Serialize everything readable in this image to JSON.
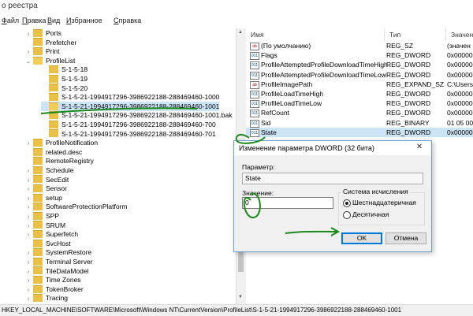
{
  "window": {
    "title": "о реестра"
  },
  "menu": [
    "Файл",
    "Правка",
    "Вид",
    "Избранное",
    "Справка"
  ],
  "tree": {
    "items": [
      {
        "label": "Ports",
        "level": 1,
        "expander": "›",
        "open": false,
        "selected": false
      },
      {
        "label": "Prefetcher",
        "level": 1,
        "expander": "",
        "open": false,
        "selected": false
      },
      {
        "label": "Print",
        "level": 1,
        "expander": "›",
        "open": false,
        "selected": false
      },
      {
        "label": "ProfileList",
        "level": 1,
        "expander": "⌄",
        "open": true,
        "selected": false
      },
      {
        "label": "S-1-5-18",
        "level": 2,
        "expander": "",
        "open": false,
        "selected": false
      },
      {
        "label": "S-1-5-19",
        "level": 2,
        "expander": "",
        "open": false,
        "selected": false
      },
      {
        "label": "S-1-5-20",
        "level": 2,
        "expander": "",
        "open": false,
        "selected": false
      },
      {
        "label": "S-1-5-21-1994917296-3986922188-288469460-1000",
        "level": 2,
        "expander": "",
        "open": false,
        "selected": false
      },
      {
        "label": "S-1-5-21-1994917296-3986922188-288469460-1001",
        "level": 2,
        "expander": "",
        "open": true,
        "selected": true
      },
      {
        "label": "S-1-5-21-1994917296-3986922188-288469460-1001.bak",
        "level": 2,
        "expander": "",
        "open": false,
        "selected": false
      },
      {
        "label": "S-1-5-21-1994917296-3986922188-288469460-700",
        "level": 2,
        "expander": "",
        "open": false,
        "selected": false
      },
      {
        "label": "S-1-5-21-1994917296-3986922188-288469460-701",
        "level": 2,
        "expander": "",
        "open": false,
        "selected": false
      },
      {
        "label": "ProfileNotification",
        "level": 1,
        "expander": "›",
        "open": false,
        "selected": false
      },
      {
        "label": "related.desc",
        "level": 1,
        "expander": "",
        "open": false,
        "selected": false
      },
      {
        "label": "RemoteRegistry",
        "level": 1,
        "expander": "",
        "open": false,
        "selected": false
      },
      {
        "label": "Schedule",
        "level": 1,
        "expander": "›",
        "open": false,
        "selected": false
      },
      {
        "label": "SecEdit",
        "level": 1,
        "expander": "›",
        "open": false,
        "selected": false
      },
      {
        "label": "Sensor",
        "level": 1,
        "expander": "›",
        "open": false,
        "selected": false
      },
      {
        "label": "setup",
        "level": 1,
        "expander": "›",
        "open": false,
        "selected": false
      },
      {
        "label": "SoftwareProtectionPlatform",
        "level": 1,
        "expander": "›",
        "open": false,
        "selected": false
      },
      {
        "label": "SPP",
        "level": 1,
        "expander": "›",
        "open": false,
        "selected": false
      },
      {
        "label": "SRUM",
        "level": 1,
        "expander": "›",
        "open": false,
        "selected": false
      },
      {
        "label": "Superfetch",
        "level": 1,
        "expander": "›",
        "open": false,
        "selected": false
      },
      {
        "label": "SvcHost",
        "level": 1,
        "expander": "",
        "open": false,
        "selected": false
      },
      {
        "label": "SystemRestore",
        "level": 1,
        "expander": "›",
        "open": false,
        "selected": false
      },
      {
        "label": "Terminal Server",
        "level": 1,
        "expander": "›",
        "open": false,
        "selected": false
      },
      {
        "label": "TileDataModel",
        "level": 1,
        "expander": "›",
        "open": false,
        "selected": false
      },
      {
        "label": "Time Zones",
        "level": 1,
        "expander": "›",
        "open": false,
        "selected": false
      },
      {
        "label": "TokenBroker",
        "level": 1,
        "expander": "›",
        "open": false,
        "selected": false
      },
      {
        "label": "Tracing",
        "level": 1,
        "expander": "›",
        "open": false,
        "selected": false
      }
    ]
  },
  "values_pane": {
    "columns": [
      "Имя",
      "Тип",
      "Значен"
    ],
    "rows": [
      {
        "name": "(По умолчанию)",
        "type": "REG_SZ",
        "value": "(значен",
        "icon": "ab"
      },
      {
        "name": "Flags",
        "type": "REG_DWORD",
        "value": "0x000000",
        "icon": "011"
      },
      {
        "name": "ProfileAttemptedProfileDownloadTimeHigh",
        "type": "REG_DWORD",
        "value": "0x000000",
        "icon": "011"
      },
      {
        "name": "ProfileAttemptedProfileDownloadTimeLow",
        "type": "REG_DWORD",
        "value": "0x000000",
        "icon": "011"
      },
      {
        "name": "ProfileImagePath",
        "type": "REG_EXPAND_SZ",
        "value": "C:\\Users",
        "icon": "ab"
      },
      {
        "name": "ProfileLoadTimeHigh",
        "type": "REG_DWORD",
        "value": "0x000000",
        "icon": "011"
      },
      {
        "name": "ProfileLoadTimeLow",
        "type": "REG_DWORD",
        "value": "0x000000",
        "icon": "011"
      },
      {
        "name": "RefCount",
        "type": "REG_DWORD",
        "value": "0x000000",
        "icon": "011"
      },
      {
        "name": "Sid",
        "type": "REG_BINARY",
        "value": "01 05 00",
        "icon": "011"
      },
      {
        "name": "State",
        "type": "REG_DWORD",
        "value": "0x000000",
        "icon": "011"
      }
    ]
  },
  "dialog": {
    "title": "Изменение параметра DWORD (32 бита)",
    "close": "✕",
    "param_label": "Параметр:",
    "param_value": "State",
    "value_label": "Значение:",
    "value_value": "0",
    "base_group_label": "Система исчисления",
    "radio_hex": "Шестнадцатеричная",
    "radio_dec": "Десятичная",
    "base_selected": "hex",
    "ok": "OK",
    "cancel": "Отмена"
  },
  "statusbar": {
    "path": "HKEY_LOCAL_MACHINE\\SOFTWARE\\Microsoft\\Windows NT\\CurrentVersion\\ProfileList\\S-1-5-21-1994917296-3986922188-288469460-1001"
  },
  "icons": {
    "scroll_up": "scroll-up-arrow-icon",
    "scroll_down": "scroll-down-arrow-icon"
  },
  "colors": {
    "selection": "#cce4f7",
    "annotation": "#1a8a1a",
    "folder": "#e8c04a"
  }
}
